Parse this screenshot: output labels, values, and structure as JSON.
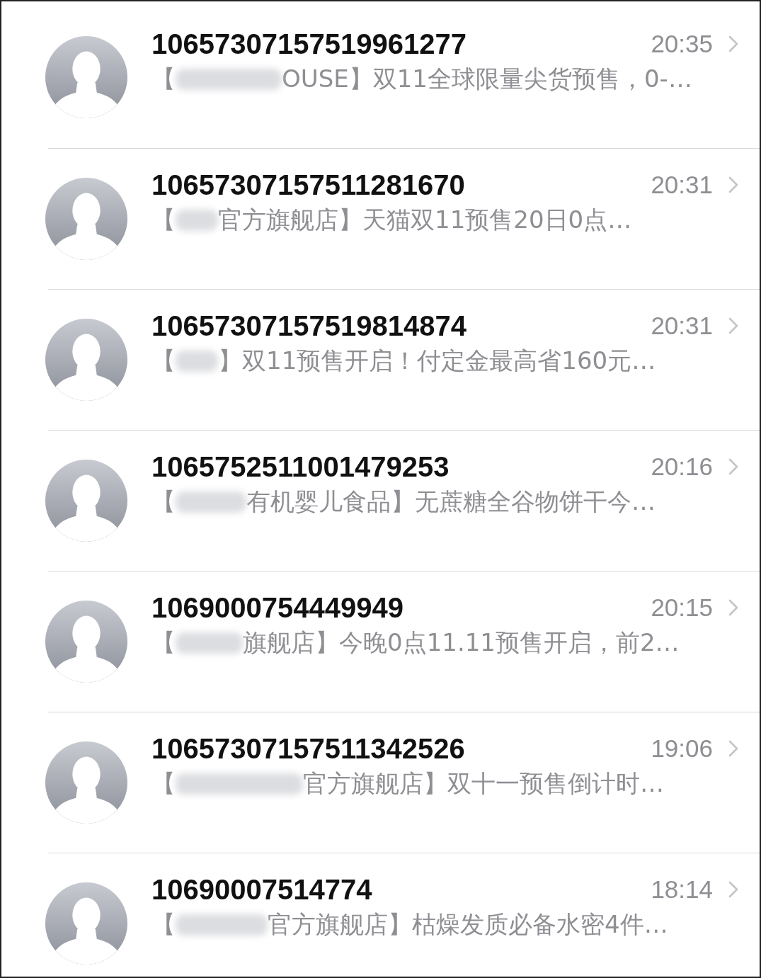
{
  "conversations": [
    {
      "sender": "10657307157519961277",
      "time": "20:35",
      "preview_start": "【",
      "redacted": true,
      "preview_end": "OUSE】双11全球限量尖货预售，0-…"
    },
    {
      "sender": "10657307157511281670",
      "time": "20:31",
      "preview_start": "【",
      "redacted": true,
      "preview_end": "官方旗舰店】天猫双11预售20日0点…"
    },
    {
      "sender": "10657307157519814874",
      "time": "20:31",
      "preview_start": "【",
      "redacted": true,
      "preview_end": "】双11预售开启！付定金最高省160元…"
    },
    {
      "sender": "1065752511001479253",
      "time": "20:16",
      "preview_start": "【",
      "redacted": true,
      "preview_end": "有机婴儿食品】无蔗糖全谷物饼干今…"
    },
    {
      "sender": "1069000754449949",
      "time": "20:15",
      "preview_start": "【",
      "redacted": true,
      "preview_end": "旗舰店】今晚0点11.11预售开启，前2…"
    },
    {
      "sender": "10657307157511342526",
      "time": "19:06",
      "preview_start": "【",
      "redacted": true,
      "preview_end": "官方旗舰店】双十一预售倒计时…"
    },
    {
      "sender": "10690007514774",
      "time": "18:14",
      "preview_start": "【",
      "redacted": true,
      "preview_end": "官方旗舰店】枯燥发质必备水密4件…"
    }
  ]
}
